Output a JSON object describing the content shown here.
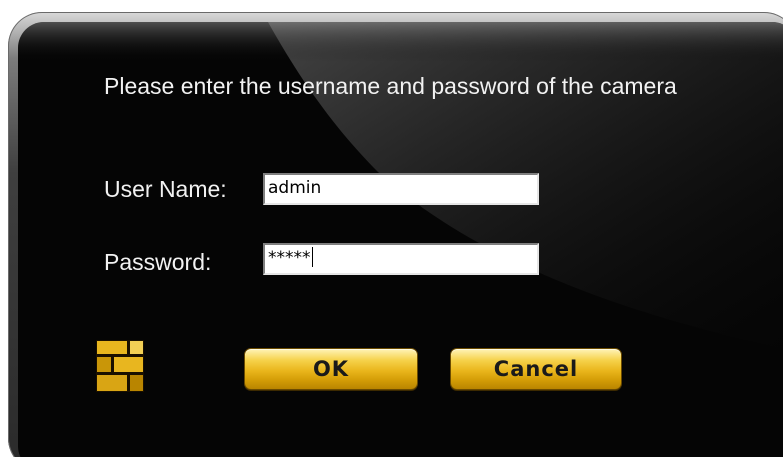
{
  "dialog": {
    "message": "Please enter the username and password of the camera",
    "username_label": "User Name:",
    "username_value": "admin",
    "password_label": "Password:",
    "password_value": "*****",
    "ok_label": "OK",
    "cancel_label": "Cancel"
  },
  "icons": {
    "brick": "brick-wall-icon"
  },
  "colors": {
    "panel_background": "#050505",
    "frame_highlight": "#d9d9d9",
    "text": "#f2f2f2",
    "button_gold": "#e9b51b",
    "brick_gold": "#e8b61f"
  }
}
